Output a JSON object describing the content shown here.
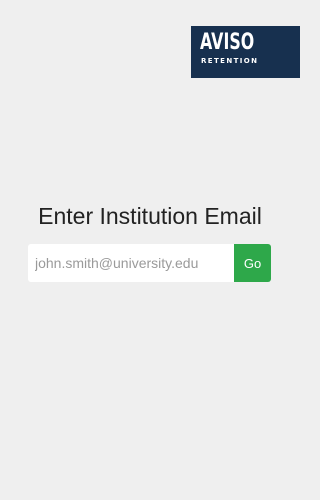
{
  "logo": {
    "main_text": "AVISO",
    "sub_text": "RETENTION",
    "background_color": "#17304f"
  },
  "heading": "Enter Institution Email",
  "email_field": {
    "value": "",
    "placeholder": "john.smith@university.edu"
  },
  "go_button": {
    "label": "Go",
    "color": "#2ea84a"
  },
  "page_background": "#efefef"
}
